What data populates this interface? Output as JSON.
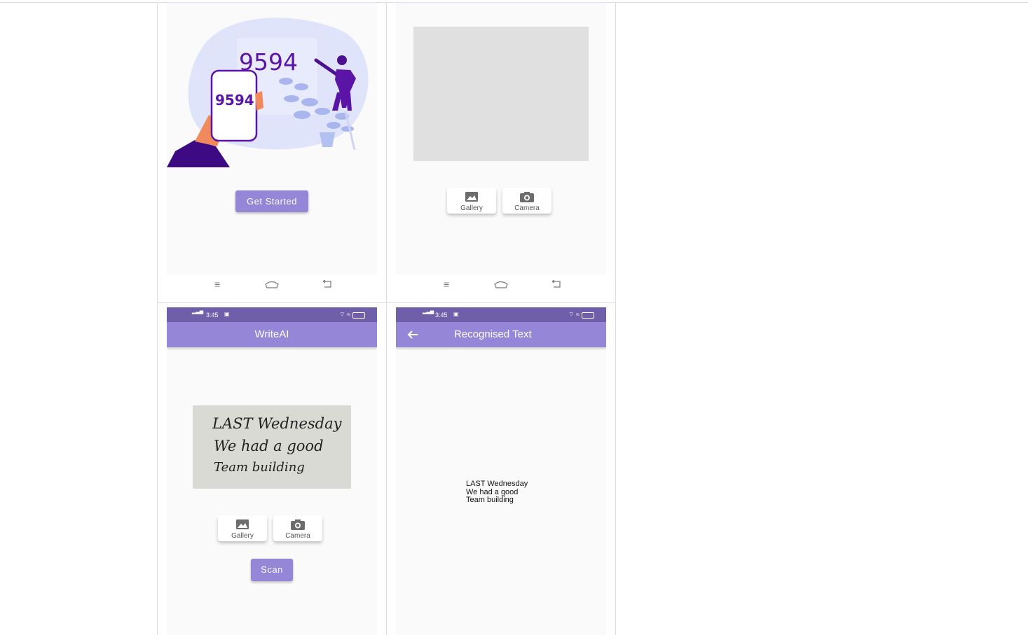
{
  "screen1": {
    "illustration": {
      "phone_number": "9594",
      "board_number": "9594"
    },
    "get_started_label": "Get Started"
  },
  "screen2": {
    "gallery_label": "Gallery",
    "camera_label": "Camera"
  },
  "screen3": {
    "status_time": "3:45",
    "app_title": "WriteAI",
    "handwriting_lines": [
      "LAST Wednesday",
      "We had a good",
      "Team building"
    ],
    "gallery_label": "Gallery",
    "camera_label": "Camera",
    "scan_label": "Scan"
  },
  "screen4": {
    "status_time": "3:45",
    "app_title": "Recognised Text",
    "recognised_lines": [
      "LAST Wednesday",
      "We had a good",
      "Team building"
    ]
  },
  "icons": {
    "menu": "menu-icon",
    "home": "home-icon",
    "back": "back-icon",
    "gallery": "image-icon",
    "camera": "camera-icon",
    "arrow_back": "arrow-left-icon"
  },
  "colors": {
    "primary": "#9586d8",
    "status_bar": "#6f5faa",
    "illustration_purple": "#5a14a6",
    "blob": "#dfe4fb"
  }
}
